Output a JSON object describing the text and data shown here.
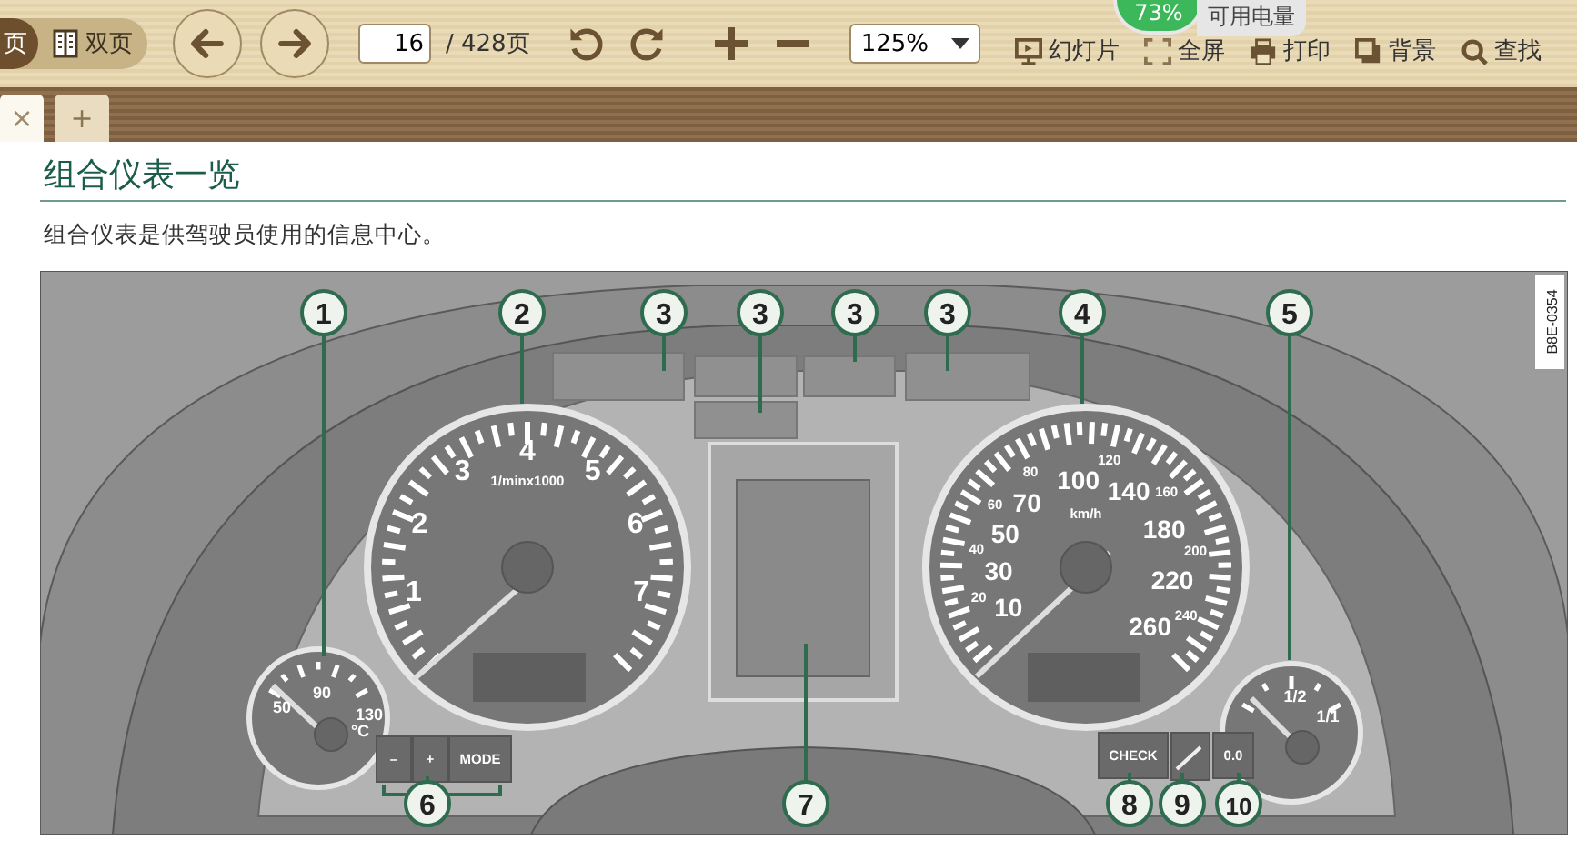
{
  "toolbar": {
    "view_modes": [
      {
        "label": "页",
        "selected": true
      },
      {
        "label": "双页",
        "selected": false
      }
    ],
    "page_input": {
      "value": "16"
    },
    "page_total": "/ 428页",
    "zoom_select": {
      "value": "125%"
    },
    "actions": [
      {
        "kind": "slideshow",
        "label": "幻灯片"
      },
      {
        "kind": "fullscreen",
        "label": "全屏"
      },
      {
        "kind": "print",
        "label": "打印"
      },
      {
        "kind": "background",
        "label": "背景"
      },
      {
        "kind": "find",
        "label": "查找"
      }
    ]
  },
  "battery_widget": {
    "percent": "73%",
    "label": "可用电量"
  },
  "tabs": [
    {
      "kind": "document",
      "close": "×",
      "selected": true
    },
    {
      "kind": "new",
      "label": "+",
      "selected": false
    }
  ],
  "document": {
    "heading": "组合仪表一览",
    "paragraph": "组合仪表是供驾驶员使用的信息中心。",
    "figure": {
      "code": "B8E-0354",
      "callouts": [
        "1",
        "2",
        "3",
        "3",
        "3",
        "3",
        "4",
        "5",
        "6",
        "7",
        "8",
        "9",
        "10"
      ],
      "tachometer": {
        "labels": [
          "1",
          "2",
          "3",
          "4",
          "5",
          "6",
          "7"
        ],
        "unit": "1/minx1000"
      },
      "speedometer": {
        "left_major_labels": [
          "70",
          "50",
          "30",
          "10"
        ],
        "left_minor_labels": [
          "80",
          "60",
          "40",
          "20"
        ],
        "right_major_labels": [
          "100",
          "140",
          "180",
          "220",
          "260"
        ],
        "right_minor_labels": [
          "120",
          "160",
          "200",
          "240"
        ],
        "unit": "km/h"
      },
      "temperature": {
        "labels": [
          "50",
          "90",
          "130"
        ],
        "unit": "°C"
      },
      "fuel": {
        "labels": [
          "1/2",
          "1/1"
        ]
      },
      "buttons": [
        "–",
        "+",
        "MODE",
        "CHECK",
        "0.0"
      ]
    }
  }
}
